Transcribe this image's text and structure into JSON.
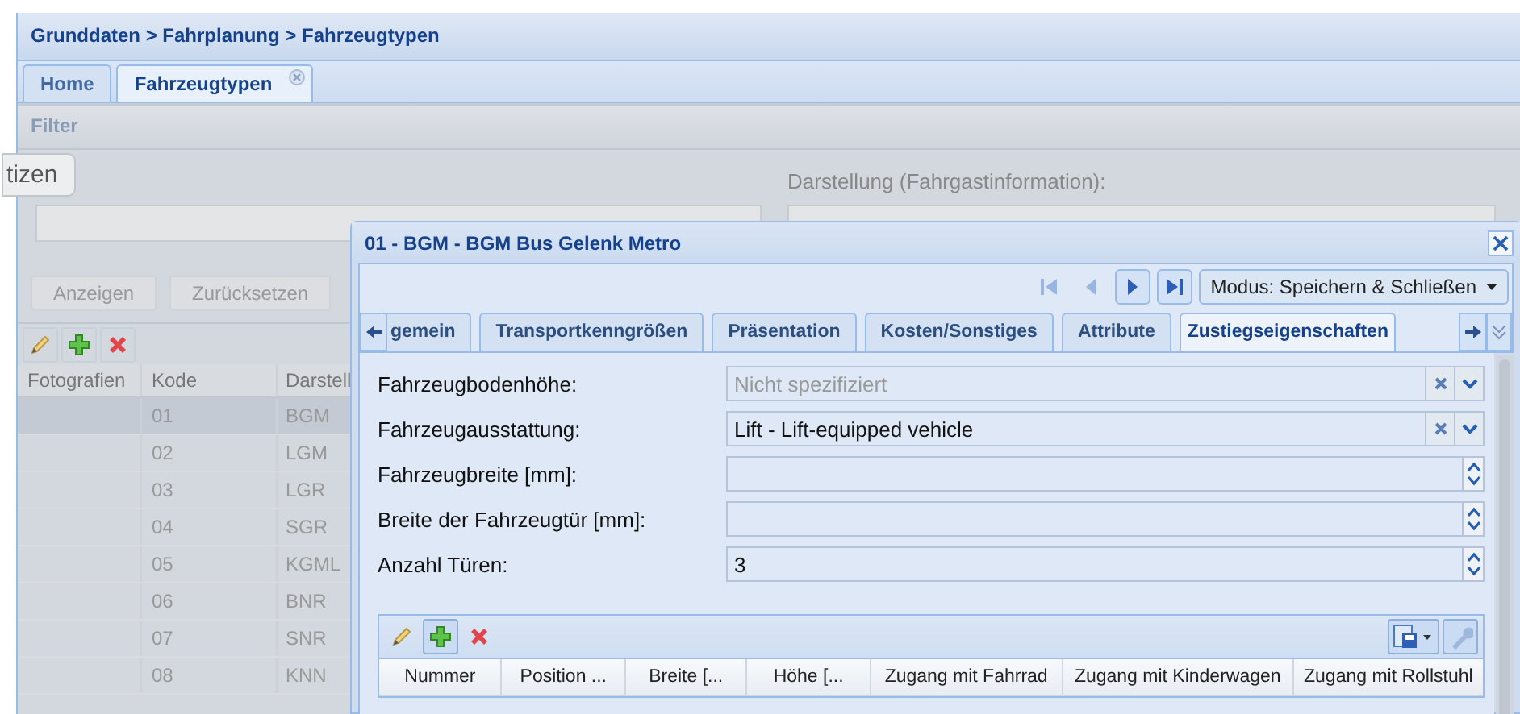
{
  "breadcrumb": "Grunddaten > Fahrplanung > Fahrzeugtypen",
  "tabs": [
    {
      "label": "Home",
      "selected": false,
      "closable": false
    },
    {
      "label": "Fahrzeugtypen",
      "selected": true,
      "closable": true
    }
  ],
  "filter": {
    "title": "Filter",
    "side_tab": "tizen",
    "field_label": "Darstellung (Fahrgastinformation):",
    "buttons": [
      "Anzeigen",
      "Zurücksetzen"
    ]
  },
  "grid": {
    "columns": [
      "Fotografien",
      "Kode",
      "Darstell"
    ],
    "rows": [
      {
        "code": "01",
        "name": "BGM",
        "selected": true
      },
      {
        "code": "02",
        "name": "LGM",
        "selected": false
      },
      {
        "code": "03",
        "name": "LGR",
        "selected": false
      },
      {
        "code": "04",
        "name": "SGR",
        "selected": false
      },
      {
        "code": "05",
        "name": "KGML",
        "selected": false
      },
      {
        "code": "06",
        "name": "BNR",
        "selected": false
      },
      {
        "code": "07",
        "name": "SNR",
        "selected": false
      },
      {
        "code": "08",
        "name": "KNN",
        "selected": false
      }
    ]
  },
  "dialog": {
    "title": "01 - BGM - BGM Bus Gelenk Metro",
    "nav": [
      {
        "kind": "first",
        "disabled": true
      },
      {
        "kind": "prev",
        "disabled": true
      },
      {
        "kind": "next",
        "disabled": false
      },
      {
        "kind": "last",
        "disabled": false
      }
    ],
    "mode_button": "Modus: Speichern & Schließen",
    "tabs": [
      {
        "label": "gemein",
        "selected": false
      },
      {
        "label": "Transportkenngrößen",
        "selected": false
      },
      {
        "label": "Präsentation",
        "selected": false
      },
      {
        "label": "Kosten/Sonstiges",
        "selected": false
      },
      {
        "label": "Attribute",
        "selected": false
      },
      {
        "label": "Zustiegseigenschaften",
        "selected": true
      }
    ],
    "fields": [
      {
        "label": "Fahrzeugbodenhöhe:",
        "kind": "combo",
        "placeholder": "Nicht spezifiziert"
      },
      {
        "label": "Fahrzeugausstattung:",
        "kind": "combo",
        "value": "Lift - Lift-equipped vehicle"
      },
      {
        "label": "Fahrzeugbreite [mm]:",
        "kind": "number"
      },
      {
        "label": "Breite der Fahrzeugtür [mm]:",
        "kind": "number"
      },
      {
        "label": "Anzahl Türen:",
        "kind": "number",
        "value": "3"
      }
    ],
    "doors_grid": {
      "columns": [
        "Nummer",
        "Position ...",
        "Breite [...",
        "Höhe [...",
        "Zugang mit Fahrrad",
        "Zugang mit Kinderwagen",
        "Zugang mit Rollstuhl"
      ]
    }
  }
}
